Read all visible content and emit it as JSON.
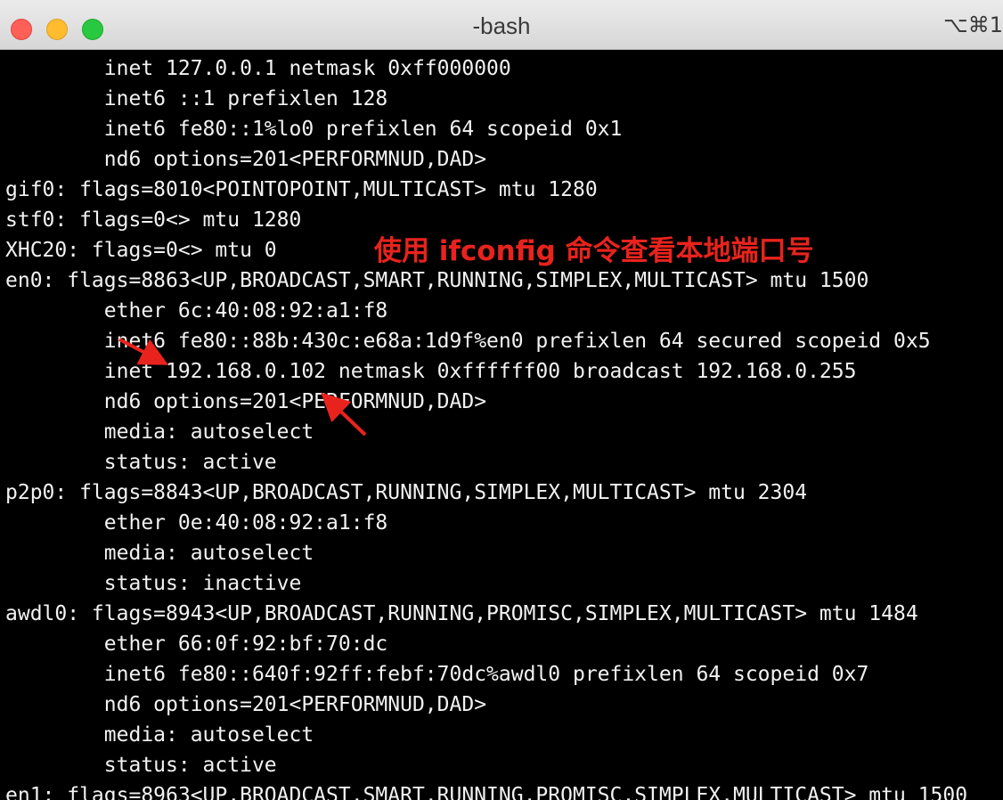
{
  "window": {
    "title": "-bash",
    "shortcut": "⌥⌘1"
  },
  "terminal": {
    "lines": [
      "        inet 127.0.0.1 netmask 0xff000000",
      "        inet6 ::1 prefixlen 128",
      "        inet6 fe80::1%lo0 prefixlen 64 scopeid 0x1",
      "        nd6 options=201<PERFORMNUD,DAD>",
      "gif0: flags=8010<POINTOPOINT,MULTICAST> mtu 1280",
      "stf0: flags=0<> mtu 1280",
      "XHC20: flags=0<> mtu 0",
      "en0: flags=8863<UP,BROADCAST,SMART,RUNNING,SIMPLEX,MULTICAST> mtu 1500",
      "        ether 6c:40:08:92:a1:f8",
      "        inet6 fe80::88b:430c:e68a:1d9f%en0 prefixlen 64 secured scopeid 0x5",
      "        inet 192.168.0.102 netmask 0xffffff00 broadcast 192.168.0.255",
      "        nd6 options=201<PERFORMNUD,DAD>",
      "        media: autoselect",
      "        status: active",
      "p2p0: flags=8843<UP,BROADCAST,RUNNING,SIMPLEX,MULTICAST> mtu 2304",
      "        ether 0e:40:08:92:a1:f8",
      "        media: autoselect",
      "        status: inactive",
      "awdl0: flags=8943<UP,BROADCAST,RUNNING,PROMISC,SIMPLEX,MULTICAST> mtu 1484",
      "        ether 66:0f:92:bf:70:dc",
      "        inet6 fe80::640f:92ff:febf:70dc%awdl0 prefixlen 64 scopeid 0x7",
      "        nd6 options=201<PERFORMNUD,DAD>",
      "        media: autoselect",
      "        status: active",
      "en1: flags=8963<UP,BROADCAST,SMART,RUNNING,PROMISC,SIMPLEX,MULTICAST> mtu 1500"
    ]
  },
  "annotation": {
    "text": "使用 ifconfig 命令查看本地端口号",
    "color": "#e8231d"
  }
}
